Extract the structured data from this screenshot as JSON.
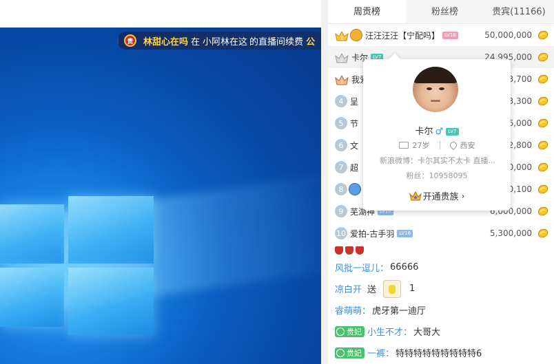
{
  "banner": {
    "user": "林甜心在吗",
    "text1": "在",
    "anchor": "小阿林在这",
    "text2": "的直播间续费",
    "tail": "公"
  },
  "tabs": [
    "周贡榜",
    "粉丝榜",
    "贵宾(11166)"
  ],
  "rank": [
    {
      "num": "1",
      "name": "汪汪汪汪【宁配吗】",
      "lv": "LV18",
      "lvColor": "pink",
      "value": "50,000,000",
      "tier": "crown-gold",
      "tierIcon": true
    },
    {
      "num": "2",
      "name": "卡尔",
      "lv": "LV7",
      "lvColor": "teal",
      "value": "24,995,000",
      "tier": "crown-silver"
    },
    {
      "num": "3",
      "name": "我爱",
      "lv": "",
      "value": "3,700",
      "tier": "crown-bronze"
    },
    {
      "num": "4",
      "name": "呈",
      "lv": "",
      "value": "3,300",
      "tier": "num"
    },
    {
      "num": "5",
      "name": "节",
      "lv": "",
      "value": "6,000",
      "tier": "num"
    },
    {
      "num": "6",
      "name": "文",
      "lv": "",
      "value": "2,800",
      "tier": "num"
    },
    {
      "num": "7",
      "name": "超",
      "lv": "",
      "value": "0,000",
      "tier": "num"
    },
    {
      "num": "8",
      "name": "",
      "lv": "",
      "value": "0,100",
      "tier": "num",
      "tierIcon": true
    },
    {
      "num": "9",
      "name": "芜湖神",
      "lv": "LV10",
      "lvColor": "blue",
      "value": "6,000,000",
      "tier": "num"
    },
    {
      "num": "10",
      "name": "爱拍-古手羽",
      "lv": "LV16",
      "lvColor": "blue",
      "value": "5,300,000",
      "tier": "num"
    }
  ],
  "popup": {
    "name": "卡尔",
    "gender": "♂",
    "lv": "LV7",
    "age": "27岁",
    "city": "西安",
    "weibo": "新浪微博：卡尔其实不太卡 直播...",
    "fans": "粉丝：10958095",
    "open_noble": "开通贵族"
  },
  "chat": [
    {
      "type": "fans"
    },
    {
      "type": "msg",
      "user": "风批一逗儿",
      "msg": "66666"
    },
    {
      "type": "gift",
      "user": "凉白开",
      "action": "送",
      "count": "1"
    },
    {
      "type": "msg",
      "user": "睿萌萌",
      "msg": "虎牙第一迪厅"
    },
    {
      "type": "noble",
      "noble": "贵妃",
      "user": "小生不才",
      "msg": "大哥大"
    },
    {
      "type": "noble",
      "noble": "贵妃",
      "user": "一裤",
      "msg": "特特特特特特特特特6"
    }
  ],
  "colors": {
    "accent_blue": "#3d8fe0",
    "gold": "#ffd24a",
    "noble_green": "#4cc06e"
  }
}
